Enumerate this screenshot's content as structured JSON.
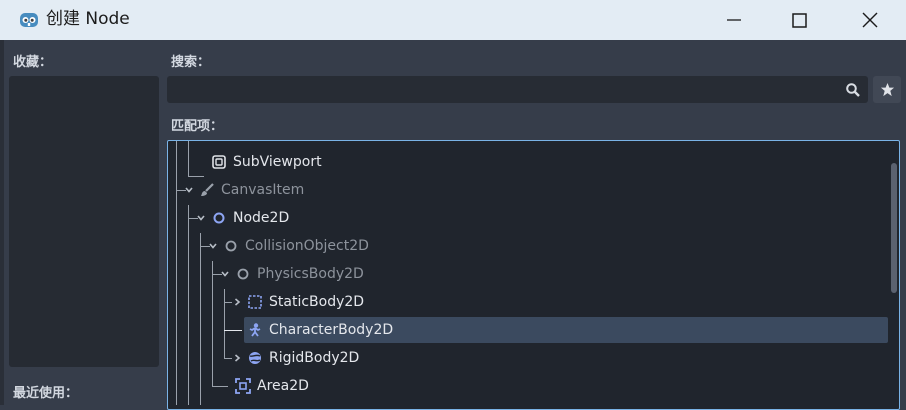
{
  "window": {
    "title": "创建 Node",
    "app_icon": "godot-icon",
    "controls": [
      "minimize-icon",
      "maximize-icon",
      "close-icon"
    ]
  },
  "favorites": {
    "label": "收藏："
  },
  "recent": {
    "label": "最近使用："
  },
  "search": {
    "label": "搜索：",
    "value": "",
    "search_icon": "search-icon",
    "favorite_icon": "star-icon"
  },
  "matches": {
    "label": "匹配项：",
    "selected": "CharacterBody2D",
    "nodes": [
      {
        "name": "SubViewport",
        "icon": "subviewport-icon",
        "dimmed": false
      },
      {
        "name": "CanvasItem",
        "icon": "brush-icon",
        "dimmed": true
      },
      {
        "name": "Node2D",
        "icon": "circle-icon",
        "dimmed": false
      },
      {
        "name": "CollisionObject2D",
        "icon": "circle-icon",
        "dimmed": true
      },
      {
        "name": "PhysicsBody2D",
        "icon": "circle-icon",
        "dimmed": true
      },
      {
        "name": "StaticBody2D",
        "icon": "static-body-icon",
        "dimmed": false
      },
      {
        "name": "CharacterBody2D",
        "icon": "character-body-icon",
        "dimmed": false
      },
      {
        "name": "RigidBody2D",
        "icon": "rigid-body-icon",
        "dimmed": false
      },
      {
        "name": "Area2D",
        "icon": "area-icon",
        "dimmed": false
      }
    ]
  },
  "colors": {
    "accent": "#7ab3e6",
    "node2d_blue": "#8da5f3",
    "selection": "#3b4a5f",
    "panel": "#20252d",
    "background": "#363d4a"
  }
}
